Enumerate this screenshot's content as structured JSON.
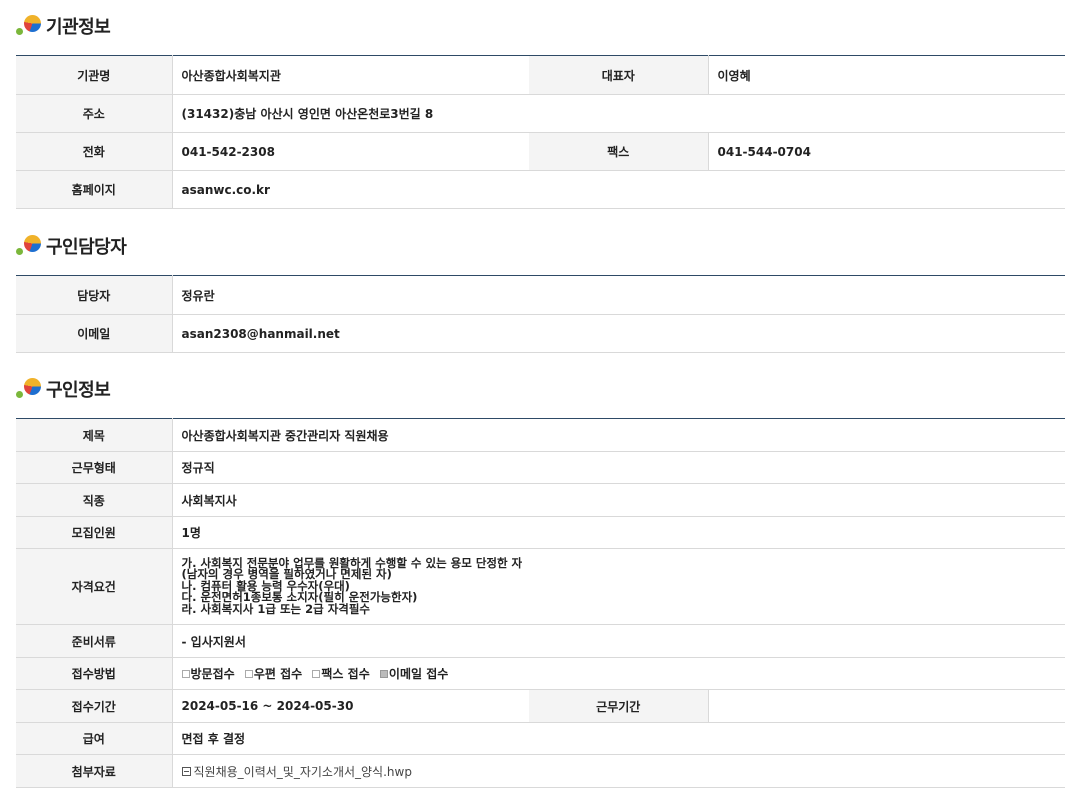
{
  "sections": {
    "org": {
      "title": "기관정보"
    },
    "contact": {
      "title": "구인담당자"
    },
    "job": {
      "title": "구인정보"
    }
  },
  "org": {
    "name_label": "기관명",
    "name": "아산종합사회복지관",
    "rep_label": "대표자",
    "rep": "이영혜",
    "addr_label": "주소",
    "addr": "(31432)충남 아산시 영인면 아산온천로3번길 8",
    "phone_label": "전화",
    "phone": "041-542-2308",
    "fax_label": "팩스",
    "fax": "041-544-0704",
    "home_label": "홈페이지",
    "home": "asanwc.co.kr"
  },
  "contact": {
    "person_label": "담당자",
    "person": "정유란",
    "email_label": "이메일",
    "email": "asan2308@hanmail.net"
  },
  "job": {
    "title_label": "제목",
    "title": "아산종합사회복지관 중간관리자 직원채용",
    "type_label": "근무형태",
    "type": "정규직",
    "category_label": "직종",
    "category": "사회복지사",
    "headcount_label": "모집인원",
    "headcount": "1명",
    "qual_label": "자격요건",
    "qual": [
      "가. 사회복지 전문분야 업무를 원활하게 수행할 수 있는 용모 단정한 자",
      "(남자의 경우 병역을 필하였거나 면제된 자)",
      "나. 컴퓨터 활용 능력 우수자(우대)",
      "다. 운전면허1종보통 소지자(필히 운전가능한자)",
      "라. 사회복지사 1급 또는 2급 자격필수"
    ],
    "docs_label": "준비서류",
    "docs": "- 입사지원서",
    "method_label": "접수방법",
    "methods": [
      {
        "label": "방문접수",
        "checked": false
      },
      {
        "label": "우편 접수",
        "checked": false
      },
      {
        "label": "팩스 접수",
        "checked": false
      },
      {
        "label": "이메일 접수",
        "checked": true
      }
    ],
    "period_label": "접수기간",
    "period": "2024-05-16 ~ 2024-05-30",
    "work_period_label": "근무기간",
    "work_period": "",
    "salary_label": "급여",
    "salary": "면접 후 결정",
    "attach_label": "첨부자료",
    "attach": "직원채용_이력서_및_자기소개서_양식.hwp",
    "attach_icon": "file-icon"
  }
}
